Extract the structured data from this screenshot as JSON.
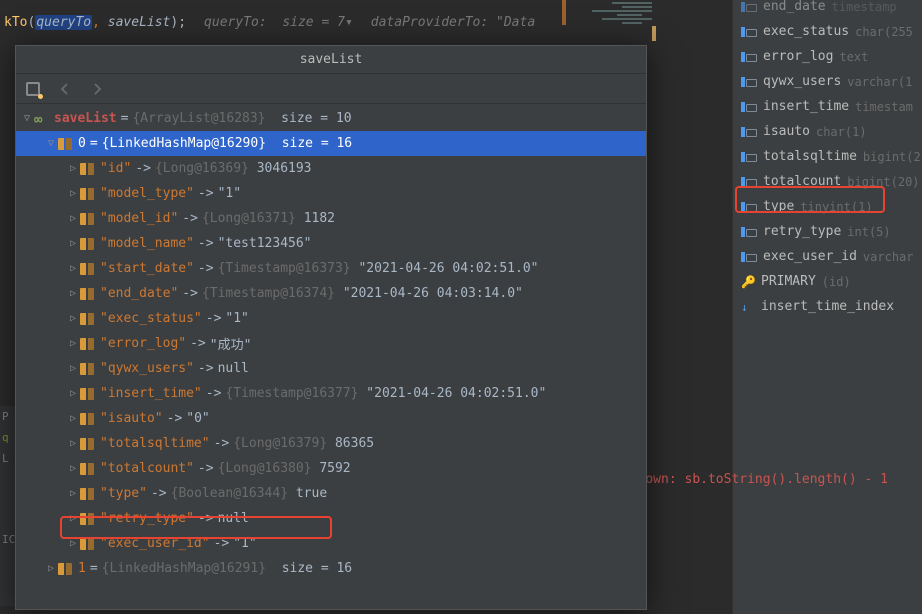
{
  "code_bg": {
    "method": "kTo",
    "arg1": "queryTo",
    "arg2": "saveList",
    "hint1_label": "queryTo:",
    "hint1_val": "size = 7",
    "hint2_label": "dataProviderTo:",
    "hint2_val": "\"Data"
  },
  "err_snippet": {
    "red": "own: sb.toString().length() - 1",
    "before": ""
  },
  "popup": {
    "title": "saveList"
  },
  "tree": {
    "root": {
      "name": "saveList",
      "ref": "{ArrayList@16283}",
      "size": "size = 10"
    },
    "entry0": {
      "idx": "0",
      "ref": "{LinkedHashMap@16290}",
      "size": "size = 16"
    },
    "items": [
      {
        "key": "\"id\"",
        "ref": "{Long@16369}",
        "val": "3046193"
      },
      {
        "key": "\"model_type\"",
        "ref": "",
        "val": "\"1\""
      },
      {
        "key": "\"model_id\"",
        "ref": "{Long@16371}",
        "val": "1182"
      },
      {
        "key": "\"model_name\"",
        "ref": "",
        "val": "\"test123456\""
      },
      {
        "key": "\"start_date\"",
        "ref": "{Timestamp@16373}",
        "val": "\"2021-04-26 04:02:51.0\""
      },
      {
        "key": "\"end_date\"",
        "ref": "{Timestamp@16374}",
        "val": "\"2021-04-26 04:03:14.0\""
      },
      {
        "key": "\"exec_status\"",
        "ref": "",
        "val": "\"1\""
      },
      {
        "key": "\"error_log\"",
        "ref": "",
        "val": "\"成功\""
      },
      {
        "key": "\"qywx_users\"",
        "ref": "",
        "val": "null"
      },
      {
        "key": "\"insert_time\"",
        "ref": "{Timestamp@16377}",
        "val": "\"2021-04-26 04:02:51.0\""
      },
      {
        "key": "\"isauto\"",
        "ref": "",
        "val": "\"0\""
      },
      {
        "key": "\"totalsqltime\"",
        "ref": "{Long@16379}",
        "val": "86365"
      },
      {
        "key": "\"totalcount\"",
        "ref": "{Long@16380}",
        "val": "7592"
      },
      {
        "key": "\"type\"",
        "ref": "{Boolean@16344}",
        "val": "true"
      },
      {
        "key": "\"retry_type\"",
        "ref": "",
        "val": "null"
      },
      {
        "key": "\"exec_user_id\"",
        "ref": "",
        "val": "\"1\""
      }
    ],
    "entry1": {
      "idx": "1",
      "ref": "{LinkedHashMap@16291}",
      "size": "size = 16"
    }
  },
  "db_cols": [
    {
      "name": "end_date",
      "type": "timestamp"
    },
    {
      "name": "exec_status",
      "type": "char(255"
    },
    {
      "name": "error_log",
      "type": "text"
    },
    {
      "name": "qywx_users",
      "type": "varchar(1"
    },
    {
      "name": "insert_time",
      "type": "timestam"
    },
    {
      "name": "isauto",
      "type": "char(1)"
    },
    {
      "name": "totalsqltime",
      "type": "bigint(2"
    },
    {
      "name": "totalcount",
      "type": "bigint(20)"
    },
    {
      "name": "type",
      "type": "tinyint(1)"
    },
    {
      "name": "retry_type",
      "type": "int(5)"
    },
    {
      "name": "exec_user_id",
      "type": "varchar"
    }
  ],
  "db_indexes": {
    "primary": {
      "name": "PRIMARY",
      "detail": "(id)"
    },
    "idx1": {
      "name": "insert_time_index",
      "detail": ""
    }
  },
  "console_tabs": {
    "t1": "P",
    "t2": "q",
    "t3": "L",
    "t4": "IC"
  }
}
